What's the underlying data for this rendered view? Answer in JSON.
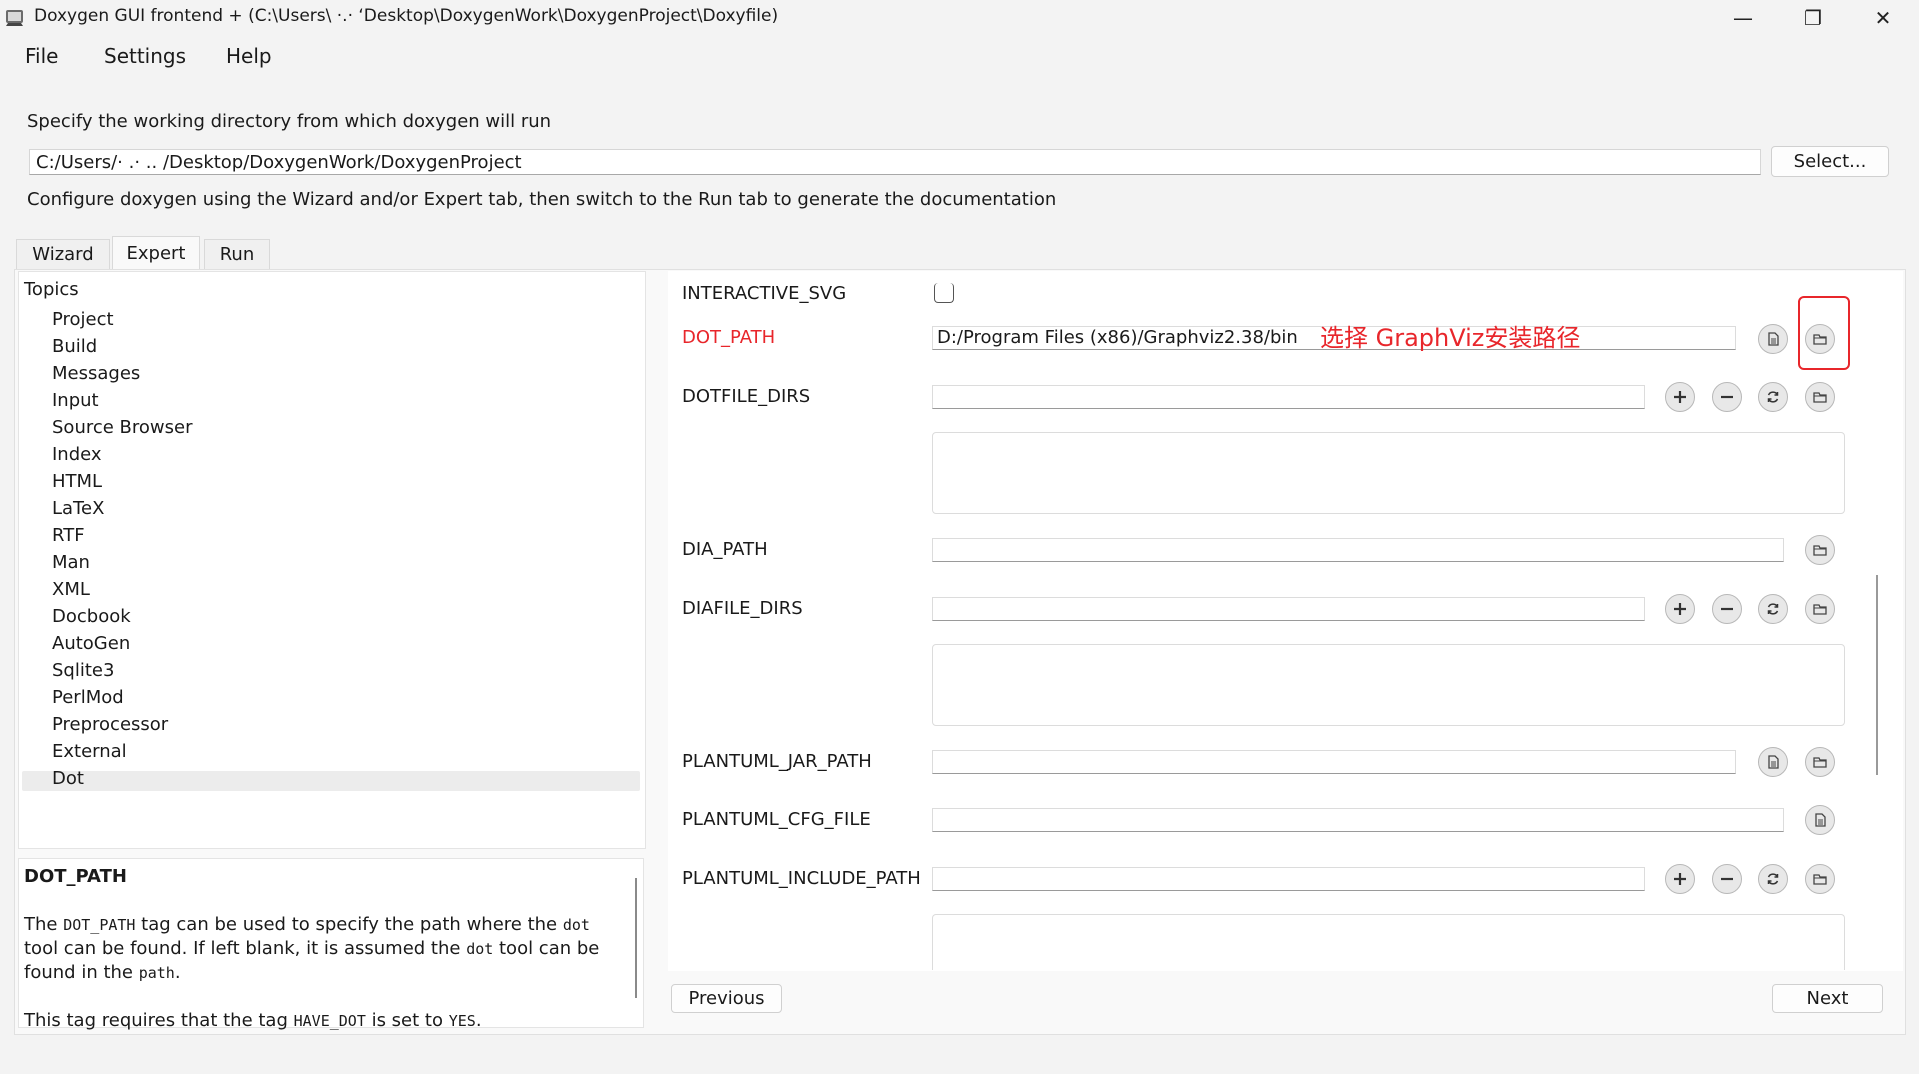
{
  "window": {
    "title": "Doxygen GUI frontend + (C:\\Users\\ ·.·  ‘Desktop\\DoxygenWork\\DoxygenProject\\Doxyfile)",
    "minimize_label": "—",
    "maximize_label": "❐",
    "close_label": "✕"
  },
  "menu": {
    "file": "File",
    "settings": "Settings",
    "help": "Help"
  },
  "header": {
    "workdir_label": "Specify the working directory from which doxygen will run",
    "workdir_value": "C:/Users/· .· ..  /Desktop/DoxygenWork/DoxygenProject",
    "select_button": "Select...",
    "configure_hint": "Configure doxygen using the Wizard and/or Expert tab, then switch to the Run tab to generate the documentation"
  },
  "tabs": [
    {
      "label": "Wizard"
    },
    {
      "label": "Expert"
    },
    {
      "label": "Run"
    }
  ],
  "topics": {
    "header": "Topics",
    "items": [
      "Project",
      "Build",
      "Messages",
      "Input",
      "Source Browser",
      "Index",
      "HTML",
      "LaTeX",
      "RTF",
      "Man",
      "XML",
      "Docbook",
      "AutoGen",
      "Sqlite3",
      "PerlMod",
      "Preprocessor",
      "External",
      "Dot"
    ],
    "selected": "Dot"
  },
  "help": {
    "title": "DOT_PATH",
    "p1_a": "The ",
    "p1_code1": "DOT_PATH",
    "p1_b": " tag can be used to specify the path where the ",
    "p1_code2": "dot",
    "p1_c": " tool can be found. If left blank, it is assumed the ",
    "p1_code3": "dot",
    "p1_d": " tool can be found in the ",
    "p1_code4": "path",
    "p1_e": ".",
    "p2_a": "This tag requires that the tag ",
    "p2_code1": "HAVE_DOT",
    "p2_b": " is set to ",
    "p2_code2": "YES",
    "p2_c": "."
  },
  "settings": {
    "interactive_svg": "INTERACTIVE_SVG",
    "dot_path": "DOT_PATH",
    "dot_path_value": "D:/Program Files (x86)/Graphviz2.38/bin",
    "dotfile_dirs": "DOTFILE_DIRS",
    "dia_path": "DIA_PATH",
    "diafile_dirs": "DIAFILE_DIRS",
    "plantuml_jar_path": "PLANTUML_JAR_PATH",
    "plantuml_cfg_file": "PLANTUML_CFG_FILE",
    "plantuml_include_path": "PLANTUML_INCLUDE_PATH"
  },
  "annotation": "选择 GraphViz安装路径",
  "nav": {
    "previous": "Previous",
    "next": "Next"
  },
  "colors": {
    "accent_red": "#e8262b",
    "dot_path_label": "#e8262b"
  }
}
